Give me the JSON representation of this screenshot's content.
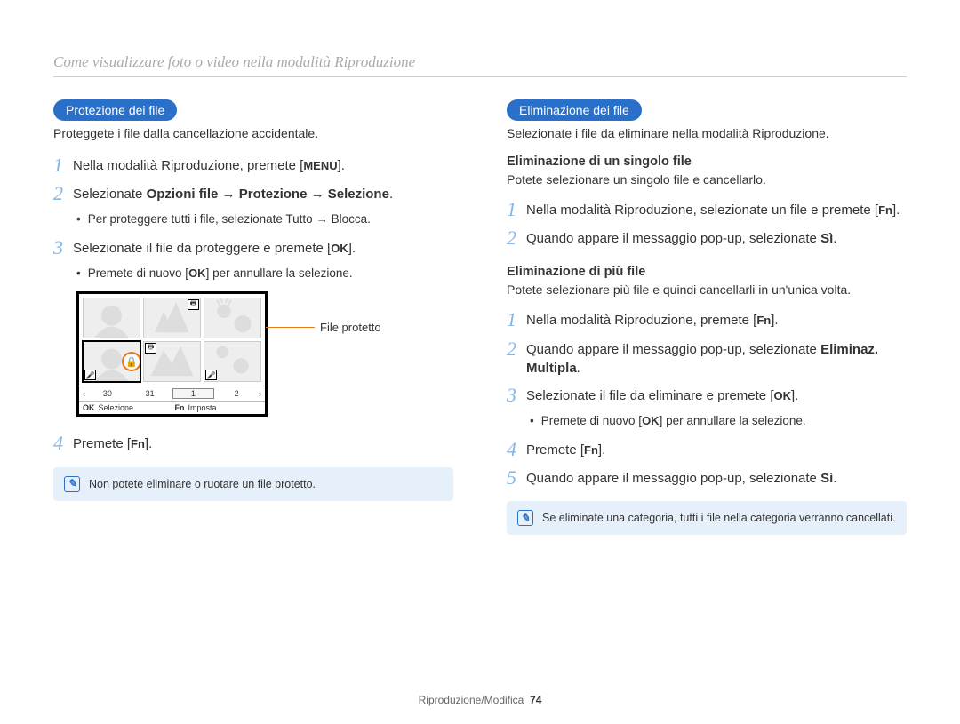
{
  "header": {
    "title": "Come visualizzare foto o video nella modalità Riproduzione"
  },
  "left": {
    "pill": "Protezione dei file",
    "desc": "Proteggete i file dalla cancellazione accidentale.",
    "steps": {
      "s1": {
        "num": "1",
        "text_a": "Nella modalità Riproduzione, premete [",
        "btn": "MENU",
        "text_b": "]."
      },
      "s2": {
        "num": "2",
        "text_a": "Selezionate ",
        "bold": "Opzioni file → Protezione → Selezione",
        "text_b": "."
      },
      "s2_bullet": {
        "text_a": "Per proteggere tutti i file, selezionate ",
        "bold": "Tutto → Blocca",
        "text_b": "."
      },
      "s3": {
        "num": "3",
        "text_a": "Selezionate il file da proteggere e premete [",
        "btn": "OK",
        "text_b": "]."
      },
      "s3_bullet": {
        "text_a": "Premete di nuovo [",
        "btn": "OK",
        "text_b": "] per annullare la selezione."
      },
      "s4": {
        "num": "4",
        "text_a": "Premete [",
        "btn": "Fn",
        "text_b": "]."
      }
    },
    "callout": "File protetto",
    "note": "Non potete eliminare o ruotare un file protetto.",
    "screen": {
      "days": {
        "d1": "30",
        "d2": "31",
        "d3": "1",
        "d4": "2"
      },
      "left_btn": "OK",
      "left_label": "Selezione",
      "right_btn": "Fn",
      "right_label": "Imposta"
    }
  },
  "right": {
    "pill": "Eliminazione dei file",
    "desc": "Selezionate i file da eliminare nella modalità Riproduzione.",
    "single": {
      "heading": "Eliminazione di un singolo file",
      "desc": "Potete selezionare un singolo file e cancellarlo.",
      "s1": {
        "num": "1",
        "text_a": "Nella modalità Riproduzione, selezionate un file e premete [",
        "btn": "Fn",
        "text_b": "]."
      },
      "s2": {
        "num": "2",
        "text_a": "Quando appare il messaggio pop-up, selezionate ",
        "bold": "Sì",
        "text_b": "."
      }
    },
    "multi": {
      "heading": "Eliminazione di più file",
      "desc": "Potete selezionare più file e quindi cancellarli in un'unica volta.",
      "s1": {
        "num": "1",
        "text_a": "Nella modalità Riproduzione, premete [",
        "btn": "Fn",
        "text_b": "]."
      },
      "s2": {
        "num": "2",
        "text_a": "Quando appare il messaggio pop-up, selezionate ",
        "bold": "Eliminaz. Multipla",
        "text_b": "."
      },
      "s3": {
        "num": "3",
        "text_a": "Selezionate il file da eliminare e premete [",
        "btn": "OK",
        "text_b": "]."
      },
      "s3_bullet": {
        "text_a": "Premete di nuovo [",
        "btn": "OK",
        "text_b": "] per annullare la selezione."
      },
      "s4": {
        "num": "4",
        "text_a": "Premete [",
        "btn": "Fn",
        "text_b": "]."
      },
      "s5": {
        "num": "5",
        "text_a": "Quando appare il messaggio pop-up, selezionate ",
        "bold": "Sì",
        "text_b": "."
      }
    },
    "note": "Se eliminate una categoria, tutti i file nella categoria verranno cancellati."
  },
  "footer": {
    "section": "Riproduzione/Modifica",
    "page": "74"
  }
}
